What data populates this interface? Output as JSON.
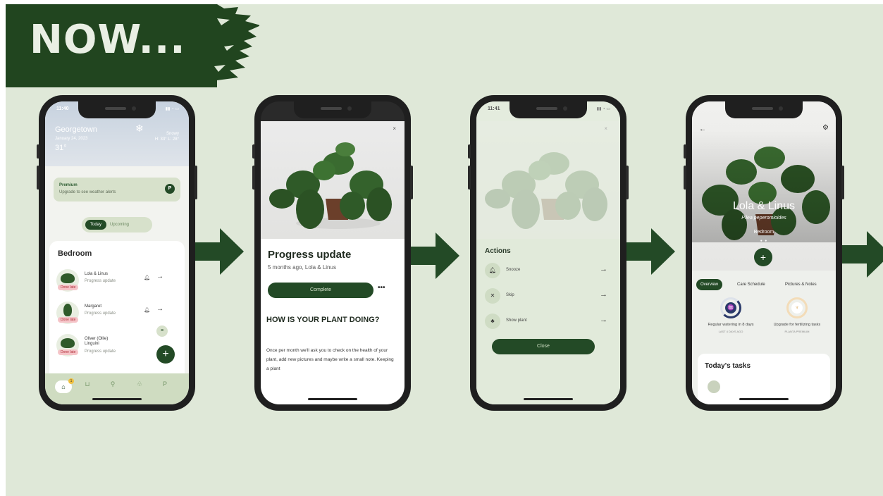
{
  "banner": {
    "text": "NOW..."
  },
  "colors": {
    "background": "#dfe8d8",
    "brand_dark_green": "#234a26",
    "banner_green": "#21451f"
  },
  "phone1": {
    "status_time": "11:40",
    "weather": {
      "city": "Georgetown",
      "date": "January 24, 2023",
      "temp": "31°",
      "condition_line1": "Snowy",
      "condition_line2": "H: 33° L: 28°"
    },
    "premium": {
      "title": "Premium",
      "subtitle": "Upgrade to see weather alerts",
      "badge": "P"
    },
    "segmented": {
      "active": "Today",
      "inactive": "Upcoming"
    },
    "room": "Bedroom",
    "plants": [
      {
        "name": "Lola & Linus",
        "task": "Progress update",
        "tag": "Done late"
      },
      {
        "name": "Margaret",
        "task": "Progress update",
        "tag": "Done late"
      },
      {
        "name": "Oliver (Ollie) Linguini",
        "task": "Progress update",
        "tag": "Done late"
      }
    ],
    "fab_label": "+",
    "tabbar": {
      "badge_count": "1",
      "profile_label": "P"
    }
  },
  "phone2": {
    "close": "×",
    "title": "Progress update",
    "subtitle": "5 months ago, Lola & Linus",
    "complete_button": "Complete",
    "more": "•••",
    "heading": "HOW IS YOUR PLANT DOING?",
    "body": "Once per month we'll ask you to check on the health of your plant, add new pictures and maybe write a small note. Keeping a plant"
  },
  "phone3": {
    "status_time": "11:41",
    "close_x": "×",
    "title": "Actions",
    "actions": [
      {
        "label": "Snooze",
        "icon": "bell-icon"
      },
      {
        "label": "Skip",
        "icon": "x-icon"
      },
      {
        "label": "Show plant",
        "icon": "plant-icon"
      }
    ],
    "close_button": "Close"
  },
  "phone4": {
    "back": "←",
    "name": "Lola & Linus",
    "scientific": "Pilea peperomioides",
    "room": "Bedroom",
    "fab": "+",
    "tabs": [
      "Overview",
      "Care Schedule",
      "Pictures & Notes"
    ],
    "stats": [
      {
        "title": "Regular watering in 8 days",
        "sub": "LAST 4 DAYS AGO",
        "icon": "watering-can-icon"
      },
      {
        "title": "Upgrade for fertilizing tasks",
        "sub": "PLANTA PREMIUM",
        "icon": "fertilizer-icon"
      }
    ],
    "tasks_title": "Today's tasks"
  }
}
